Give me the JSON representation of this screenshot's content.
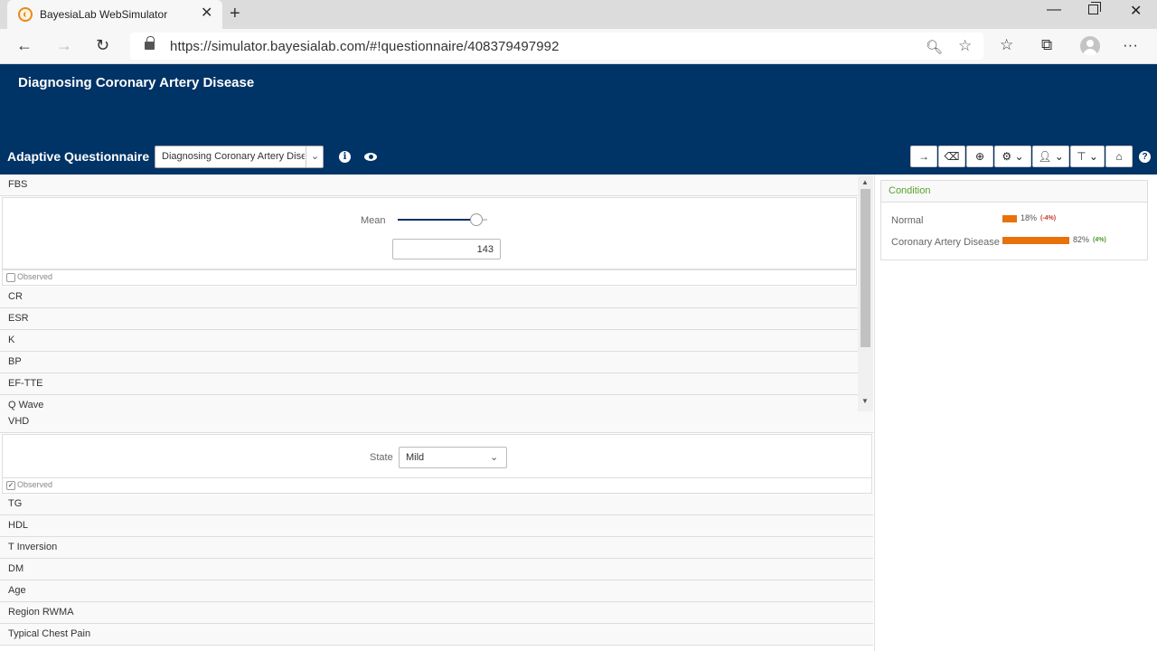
{
  "browser": {
    "tab_title": "BayesiaLab WebSimulator",
    "url": "https://simulator.bayesialab.com/#!questionnaire/408379497992"
  },
  "app": {
    "title": "Diagnosing Coronary Artery Disease",
    "questionnaire_label": "Adaptive Questionnaire",
    "questionnaire_select": "Diagnosing Coronary Artery Disease"
  },
  "toolbar": {
    "buttons": [
      "forward-arrow-icon",
      "eraser-icon",
      "add-circle-icon",
      "gear-icon",
      "user-icon",
      "hierarchy-icon",
      "home-icon"
    ]
  },
  "top_panel": {
    "expanded_var": {
      "name": "FBS",
      "mean_label": "Mean",
      "slider_fraction": 0.88,
      "value": "143",
      "observed_label": "Observed",
      "observed": false
    },
    "vars": [
      "CR",
      "ESR",
      "K",
      "BP",
      "EF-TTE",
      "Q Wave"
    ]
  },
  "bottom_panel": {
    "expanded_var": {
      "name": "VHD",
      "state_label": "State",
      "state_value": "Mild",
      "observed_label": "Observed",
      "observed": true
    },
    "vars": [
      "TG",
      "HDL",
      "T Inversion",
      "DM",
      "Age",
      "Region RWMA",
      "Typical Chest Pain"
    ]
  },
  "target": {
    "title": "Condition",
    "states": [
      {
        "name": "Normal",
        "percent": 18,
        "pct_text": "18%",
        "delta": "(-4%)",
        "delta_sign": "neg"
      },
      {
        "name": "Coronary Artery Disease",
        "percent": 82,
        "pct_text": "82%",
        "delta": "(4%)",
        "delta_sign": "pos"
      }
    ]
  }
}
